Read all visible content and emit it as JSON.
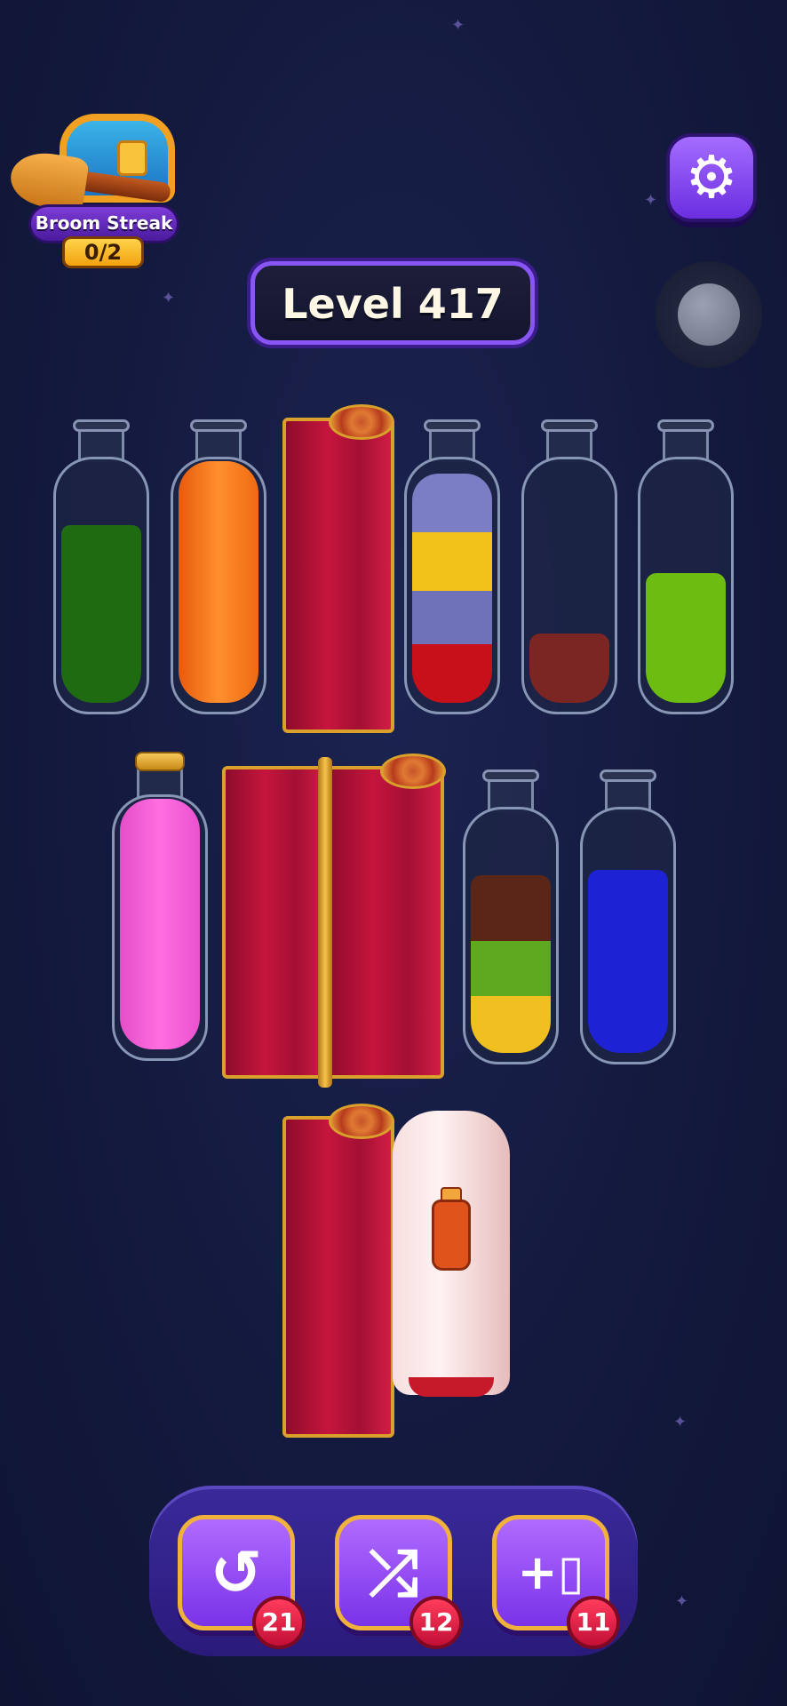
{
  "header": {
    "streak_label": "Broom Streak",
    "streak_count": "0/2",
    "level_title": "Level 417"
  },
  "icons": {
    "settings": "gear-icon",
    "undo": "undo-icon",
    "shuffle": "shuffle-icon",
    "add_bottle": "add-bottle-icon"
  },
  "colors": {
    "green": "#1f6b12",
    "orange": "#ff7a1a",
    "periwinkle": "#6f72b8",
    "yellow": "#f2c21a",
    "red": "#c8101a",
    "maroon": "#7b2622",
    "lime": "#6cbc12",
    "pink": "#f05ad4",
    "brown": "#5a2618",
    "grass": "#5ea91f",
    "gold": "#f0c021",
    "blue": "#1d22d4"
  },
  "bottles": [
    {
      "id": "b1",
      "layers": [
        "green"
      ]
    },
    {
      "id": "b2",
      "layers": [
        "orange"
      ]
    },
    {
      "id": "b4",
      "layers": [
        "red",
        "periwinkle",
        "yellow",
        "periwinkle"
      ]
    },
    {
      "id": "b5",
      "layers": [
        "maroon"
      ]
    },
    {
      "id": "b6",
      "layers": [
        "lime"
      ]
    },
    {
      "id": "b7",
      "layers": [
        "pink"
      ],
      "corked": true
    },
    {
      "id": "b9",
      "layers": [
        "gold",
        "grass",
        "brown"
      ]
    },
    {
      "id": "b10",
      "layers": [
        "blue"
      ]
    }
  ],
  "boosters": {
    "undo_count": "21",
    "shuffle_count": "12",
    "add_bottle_count": "11"
  }
}
